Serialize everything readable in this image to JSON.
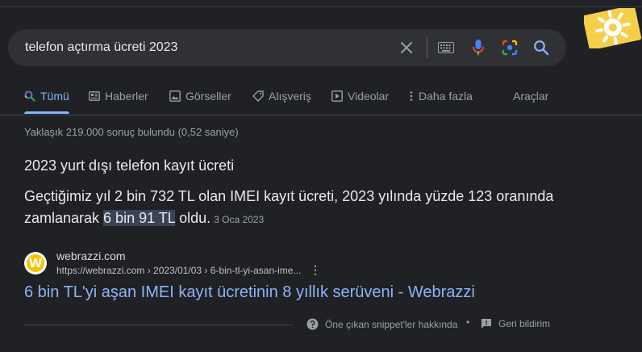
{
  "search": {
    "query": "telefon açtırma ücreti 2023"
  },
  "icons": {
    "clear": "close-icon",
    "keyboard": "keyboard-icon",
    "voice": "microphone-icon",
    "lens": "camera-lens-icon",
    "search": "search-icon"
  },
  "tabs": [
    {
      "label": "Tümü",
      "icon": "search-icon",
      "active": true
    },
    {
      "label": "Haberler",
      "icon": "news-icon"
    },
    {
      "label": "Görseller",
      "icon": "image-icon"
    },
    {
      "label": "Alışveriş",
      "icon": "tag-icon"
    },
    {
      "label": "Videolar",
      "icon": "play-icon"
    },
    {
      "label": "Daha fazla",
      "icon": "more-vertical-icon"
    }
  ],
  "tools_label": "Araçlar",
  "result_stats": "Yaklaşık 219.000 sonuç bulundu (0,52 saniye)",
  "featured_snippet": {
    "heading": "2023 yurt dışı telefon kayıt ücreti",
    "answer_before": "Geçtiğimiz yıl 2 bin 732 TL olan IMEI kayıt ücreti, 2023 yılında yüzde 123 oranında zamlanarak ",
    "answer_highlight": "6 bin 91 TL",
    "answer_after": " oldu.",
    "date": "3 Oca 2023"
  },
  "source": {
    "favicon_letter": "W",
    "site_name": "webrazzi.com",
    "url": "https://webrazzi.com › 2023/01/03 › 6-bin-tl-yi-asan-ime...",
    "more": "⋮",
    "title": "6 bin TL'yi aşan IMEI kayıt ücretinin 8 yıllık serüveni - Webrazzi"
  },
  "footer": {
    "about_snippets": "Öne çıkan snippet'ler hakkında",
    "separator": "•",
    "feedback": "Geri bildirim"
  },
  "colors": {
    "background": "#202124",
    "link": "#8ab4f8",
    "highlight": "#394457",
    "text": "#e8eaed"
  }
}
